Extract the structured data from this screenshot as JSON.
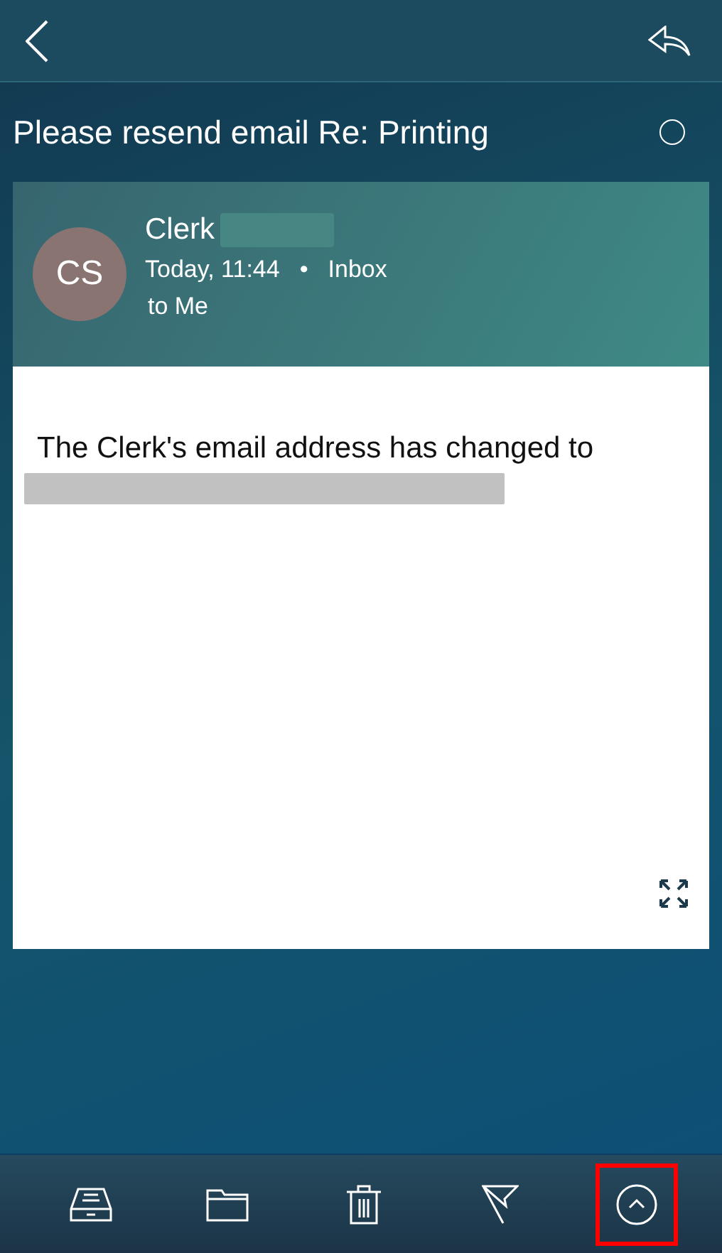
{
  "subject": "Please resend email Re: Printing",
  "read_marker": {
    "selected": false
  },
  "sender": {
    "initials": "CS",
    "name": "Clerk",
    "surname_redacted": true,
    "time": "Today, 11:44",
    "separator": "•",
    "folder": "Inbox",
    "recipient": "to Me"
  },
  "body": {
    "text": "The Clerk's email address has changed to",
    "address_redacted": true
  },
  "toolbar": [
    {
      "kind": "archive",
      "highlighted": false
    },
    {
      "kind": "folder",
      "highlighted": false
    },
    {
      "kind": "trash",
      "highlighted": false
    },
    {
      "kind": "flag",
      "highlighted": false
    },
    {
      "kind": "up",
      "highlighted": true
    }
  ]
}
